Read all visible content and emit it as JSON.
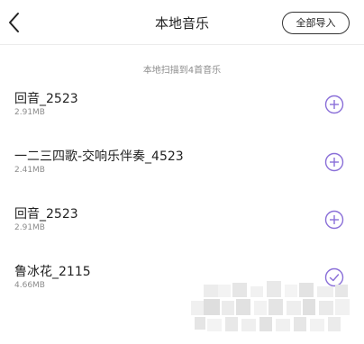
{
  "header": {
    "title": "本地音乐",
    "import_all_label": "全部导入"
  },
  "scan_info": "本地扫描到4首音乐",
  "songs": [
    {
      "title": "回音_2523",
      "size": "2.91MB",
      "status": "add"
    },
    {
      "title": "一二三四歌-交响乐伴奏_4523",
      "size": "2.41MB",
      "status": "add"
    },
    {
      "title": "回音_2523",
      "size": "2.91MB",
      "status": "add"
    },
    {
      "title": "鲁冰花_2115",
      "size": "4.66MB",
      "status": "imported"
    }
  ],
  "colors": {
    "accent": "#8a6fd8",
    "text": "#222222",
    "muted": "#8c8c8c"
  }
}
